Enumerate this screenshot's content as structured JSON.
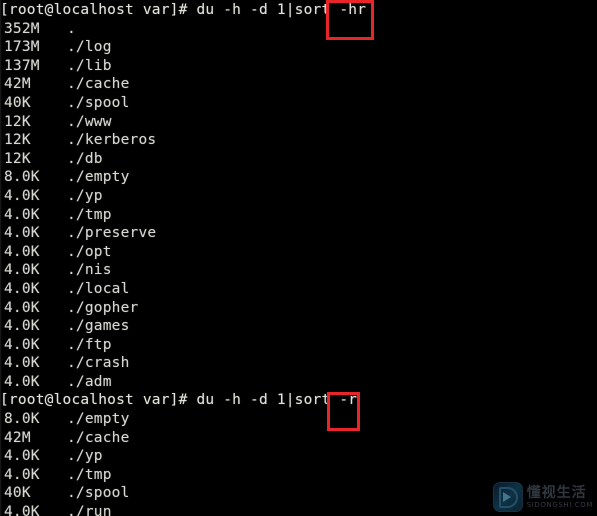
{
  "terminal": {
    "lines": [
      {
        "kind": "prompt",
        "text": "[root@localhost var]# du -h -d 1|sort -hr"
      },
      {
        "kind": "entry",
        "size": "352M",
        "path": "."
      },
      {
        "kind": "entry",
        "size": "173M",
        "path": "./log"
      },
      {
        "kind": "entry",
        "size": "137M",
        "path": "./lib"
      },
      {
        "kind": "entry",
        "size": "42M",
        "path": "./cache"
      },
      {
        "kind": "entry",
        "size": "40K",
        "path": "./spool"
      },
      {
        "kind": "entry",
        "size": "12K",
        "path": "./www"
      },
      {
        "kind": "entry",
        "size": "12K",
        "path": "./kerberos"
      },
      {
        "kind": "entry",
        "size": "12K",
        "path": "./db"
      },
      {
        "kind": "entry",
        "size": "8.0K",
        "path": "./empty"
      },
      {
        "kind": "entry",
        "size": "4.0K",
        "path": "./yp"
      },
      {
        "kind": "entry",
        "size": "4.0K",
        "path": "./tmp"
      },
      {
        "kind": "entry",
        "size": "4.0K",
        "path": "./preserve"
      },
      {
        "kind": "entry",
        "size": "4.0K",
        "path": "./opt"
      },
      {
        "kind": "entry",
        "size": "4.0K",
        "path": "./nis"
      },
      {
        "kind": "entry",
        "size": "4.0K",
        "path": "./local"
      },
      {
        "kind": "entry",
        "size": "4.0K",
        "path": "./gopher"
      },
      {
        "kind": "entry",
        "size": "4.0K",
        "path": "./games"
      },
      {
        "kind": "entry",
        "size": "4.0K",
        "path": "./ftp"
      },
      {
        "kind": "entry",
        "size": "4.0K",
        "path": "./crash"
      },
      {
        "kind": "entry",
        "size": "4.0K",
        "path": "./adm"
      },
      {
        "kind": "prompt",
        "text": "[root@localhost var]# du -h -d 1|sort -r"
      },
      {
        "kind": "entry",
        "size": "8.0K",
        "path": "./empty"
      },
      {
        "kind": "entry",
        "size": "42M",
        "path": "./cache"
      },
      {
        "kind": "entry",
        "size": "4.0K",
        "path": "./yp"
      },
      {
        "kind": "entry",
        "size": "4.0K",
        "path": "./tmp"
      },
      {
        "kind": "entry",
        "size": "40K",
        "path": "./spool"
      },
      {
        "kind": "entry",
        "size": "4.0K",
        "path": "./run"
      }
    ],
    "background_color": "#000000",
    "text_color": "#d7d7d2"
  },
  "annotations": {
    "highlight_color": "#e8262a",
    "boxes": [
      {
        "name": "sort-hr-flag",
        "label": "-hr"
      },
      {
        "name": "sort-r-flag",
        "label": "-r"
      }
    ]
  },
  "watermark": {
    "cn_text": "懂视生活",
    "en_text": "SIDONGSHI.COM"
  }
}
